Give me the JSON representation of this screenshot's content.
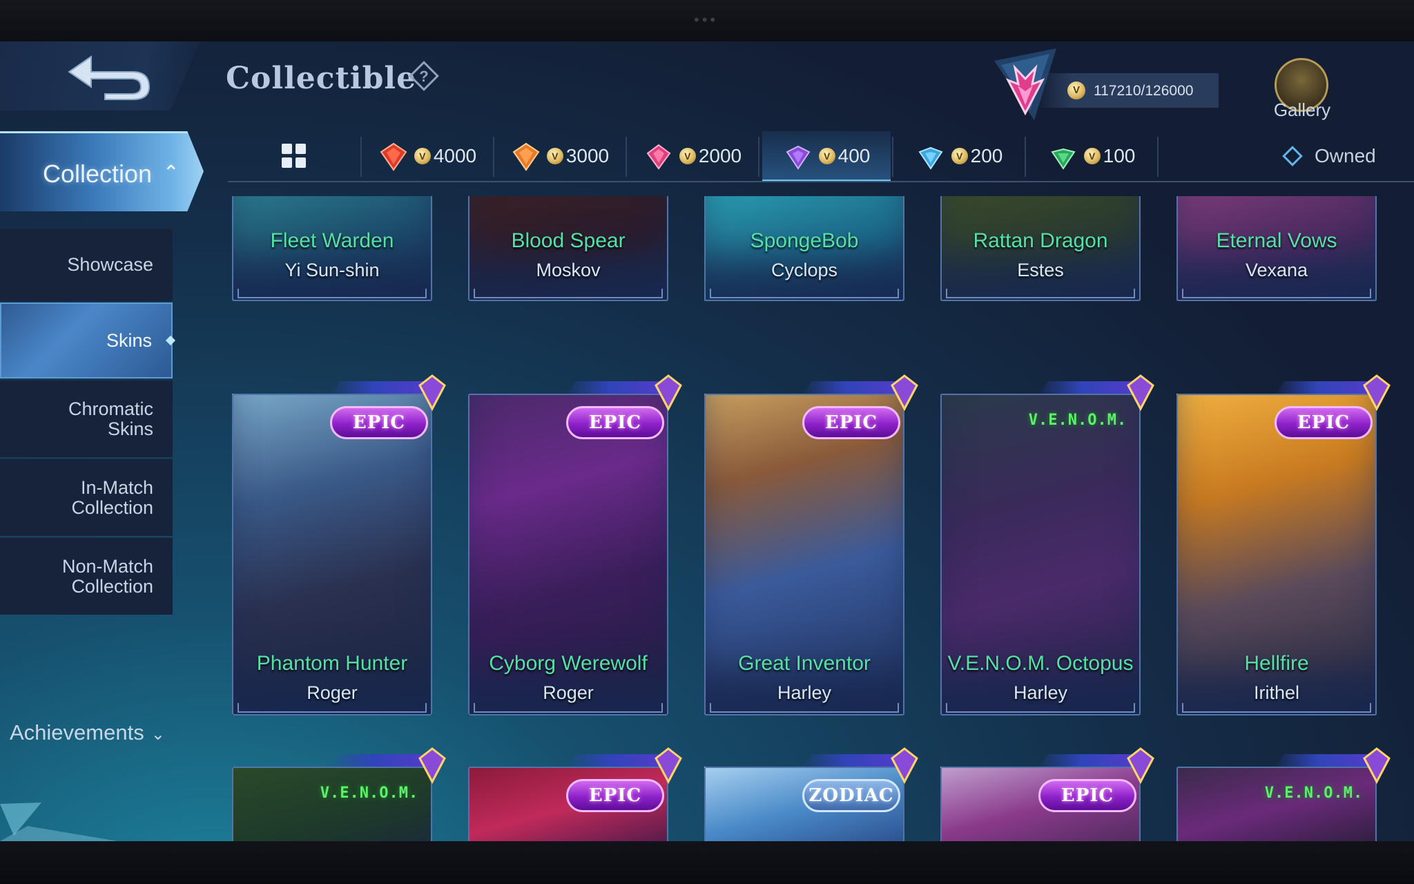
{
  "header": {
    "title": "Collectible",
    "points": "117210/126000",
    "gallery_label": "Gallery"
  },
  "tabs": [
    {
      "id": "all",
      "label": "",
      "icon": "grid-icon"
    },
    {
      "id": "t4000",
      "label": "4000",
      "icon": "red-gem-icon",
      "color": "#e03a2a"
    },
    {
      "id": "t3000",
      "label": "3000",
      "icon": "orange-gem-icon",
      "color": "#e8782a"
    },
    {
      "id": "t2000",
      "label": "2000",
      "icon": "pink-gem-icon",
      "color": "#e0407a"
    },
    {
      "id": "t400",
      "label": "400",
      "icon": "purple-gem-icon",
      "color": "#8a4ad8",
      "active": true
    },
    {
      "id": "t200",
      "label": "200",
      "icon": "blue-gem-icon",
      "color": "#3aa8e0"
    },
    {
      "id": "t100",
      "label": "100",
      "icon": "green-gem-icon",
      "color": "#2aa85a"
    }
  ],
  "owned_label": "Owned",
  "sidebar": {
    "collection_label": "Collection",
    "items": [
      {
        "label": "Showcase"
      },
      {
        "label": "Skins",
        "active": true
      },
      {
        "label": "Chromatic\nSkins"
      },
      {
        "label": "In-Match\nCollection"
      },
      {
        "label": "Non-Match\nCollection"
      }
    ],
    "achievements_label": "Achievements"
  },
  "cards": {
    "row1": [
      {
        "skin": "Fleet Warden",
        "hero": "Yi Sun-shin"
      },
      {
        "skin": "Blood Spear",
        "hero": "Moskov"
      },
      {
        "skin": "SpongeBob",
        "hero": "Cyclops"
      },
      {
        "skin": "Rattan Dragon",
        "hero": "Estes"
      },
      {
        "skin": "Eternal Vows",
        "hero": "Vexana"
      }
    ],
    "row2": [
      {
        "skin": "Phantom Hunter",
        "hero": "Roger",
        "badge": "EPIC"
      },
      {
        "skin": "Cyborg Werewolf",
        "hero": "Roger",
        "badge": "EPIC"
      },
      {
        "skin": "Great Inventor",
        "hero": "Harley",
        "badge": "EPIC"
      },
      {
        "skin": "V.E.N.O.M. Octopus",
        "hero": "Harley",
        "badge": "V.E.N.O.M."
      },
      {
        "skin": "Hellfire",
        "hero": "Irithel",
        "badge": "EPIC"
      }
    ],
    "row3": [
      {
        "badge": "V.E.N.O.M."
      },
      {
        "badge": "EPIC"
      },
      {
        "badge": "ZODIAC"
      },
      {
        "badge": "EPIC"
      },
      {
        "badge": "V.E.N.O.M."
      }
    ]
  }
}
